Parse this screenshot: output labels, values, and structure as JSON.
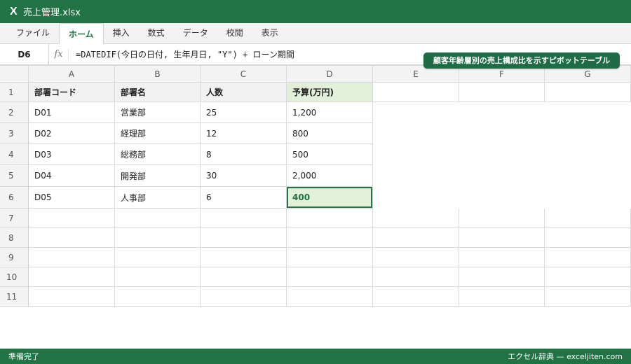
{
  "app": {
    "icon_glyph": "X",
    "title": "売上管理.xlsx"
  },
  "ribbon": {
    "tabs": [
      "ファイル",
      "ホーム",
      "挿入",
      "数式",
      "データ",
      "校閲",
      "表示"
    ],
    "active": "ホーム"
  },
  "formula_bar": {
    "name_box": "D6",
    "fx_label": "fx",
    "formula": "=DATEDIF(今日の日付, 生年月日, \"Y\") + ローン期間"
  },
  "callout": "顧客年齢層別の売上構成比を示すピボットテーブル",
  "sheet": {
    "columns": [
      "A",
      "B",
      "C",
      "D",
      "E",
      "F",
      "G"
    ],
    "row_numbers": [
      "1",
      "2",
      "3",
      "4",
      "5",
      "6",
      "7",
      "8",
      "9",
      "10",
      "11"
    ],
    "header": [
      "部署コード",
      "部署名",
      "人数",
      "予算(万円)"
    ],
    "rows": [
      [
        "D01",
        "営業部",
        "25",
        "1,200"
      ],
      [
        "D02",
        "経理部",
        "12",
        "800"
      ],
      [
        "D03",
        "総務部",
        "8",
        "500"
      ],
      [
        "D04",
        "開発部",
        "30",
        "2,000"
      ],
      [
        "D05",
        "人事部",
        "6",
        "400"
      ]
    ],
    "selected_cell": "D6"
  },
  "status": {
    "left": "準備完了",
    "right": "エクセル辞典 — exceljiten.com"
  },
  "colors": {
    "brand": "#217346",
    "selected_fill": "#e2efda",
    "callout": "#1e6b45"
  }
}
